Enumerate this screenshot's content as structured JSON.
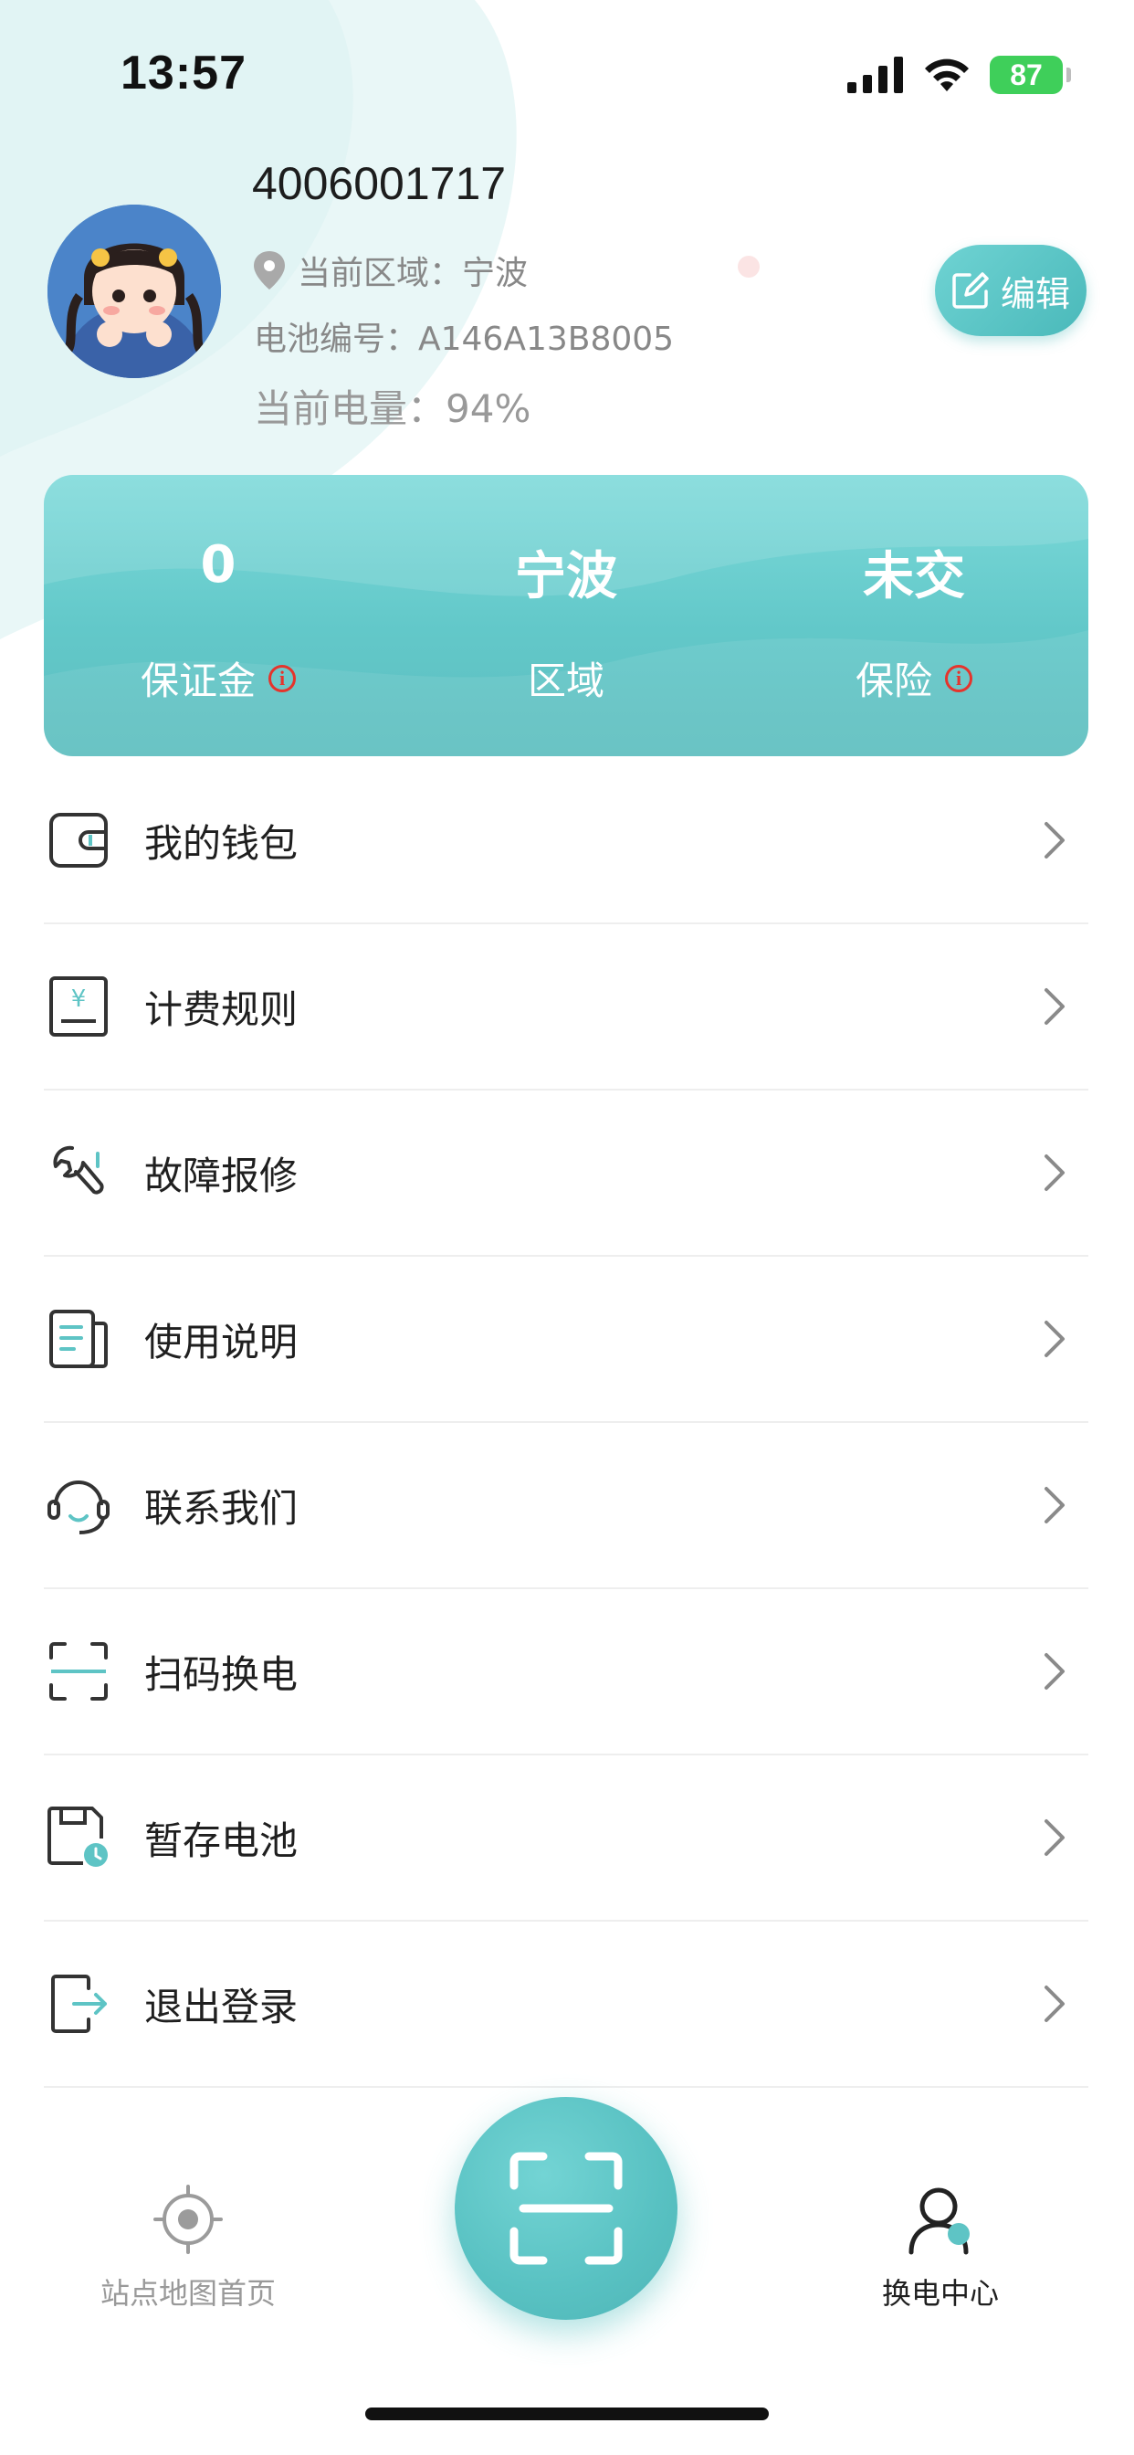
{
  "status_bar": {
    "time": "13:57",
    "battery_level": "87"
  },
  "profile": {
    "username": "4006001717",
    "region_label": "当前区域：宁波",
    "battery_id_label": "电池编号：A146A13B8005",
    "power_label": "当前电量：94%",
    "edit_label": "编辑"
  },
  "stats": [
    {
      "value": "0",
      "label": "保证金",
      "has_info": true
    },
    {
      "value": "宁波",
      "label": "区域",
      "has_info": false
    },
    {
      "value": "未交",
      "label": "保险",
      "has_info": true
    }
  ],
  "menu": [
    {
      "label": "我的钱包",
      "icon": "wallet-icon"
    },
    {
      "label": "计费规则",
      "icon": "billing-icon"
    },
    {
      "label": "故障报修",
      "icon": "wrench-icon"
    },
    {
      "label": "使用说明",
      "icon": "document-icon"
    },
    {
      "label": "联系我们",
      "icon": "headset-icon"
    },
    {
      "label": "扫码换电",
      "icon": "scan-icon"
    },
    {
      "label": "暂存电池",
      "icon": "save-battery-icon"
    },
    {
      "label": "退出登录",
      "icon": "logout-icon"
    }
  ],
  "bottom_nav": {
    "map_label": "站点地图首页",
    "center_label": "换电中心"
  },
  "colors": {
    "accent": "#5ec4c5",
    "info_red": "#e5342c",
    "battery_green": "#3fcf5a"
  }
}
